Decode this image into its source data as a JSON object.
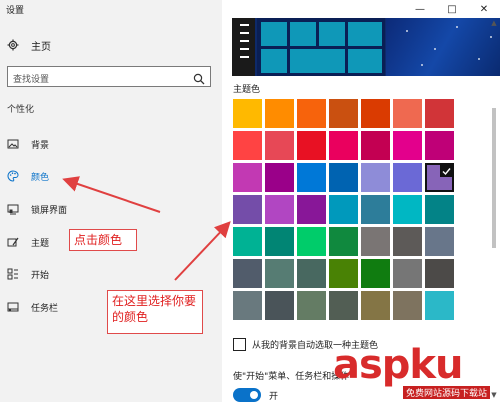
{
  "window": {
    "title": "设置"
  },
  "sidebar": {
    "home_label": "主页",
    "search_placeholder": "查找设置",
    "section_title": "个性化",
    "items": [
      {
        "label": "背景",
        "icon": "picture-icon"
      },
      {
        "label": "颜色",
        "icon": "palette-icon",
        "active": true
      },
      {
        "label": "锁屏界面",
        "icon": "lockscreen-icon"
      },
      {
        "label": "主题",
        "icon": "theme-icon"
      },
      {
        "label": "开始",
        "icon": "start-icon"
      },
      {
        "label": "任务栏",
        "icon": "taskbar-icon"
      }
    ]
  },
  "titlebar": {
    "minimize": "—",
    "maximize": "□",
    "close": "✕"
  },
  "main": {
    "theme_color_heading": "主题色",
    "selected_index": 20,
    "swatches": [
      "#FFB900",
      "#FF8C00",
      "#F7630C",
      "#CA5010",
      "#DA3B01",
      "#EF6950",
      "#D13438",
      "#FF4343",
      "#E74856",
      "#E81123",
      "#EA005E",
      "#C30052",
      "#E3008C",
      "#BF0077",
      "#C239B3",
      "#9A0089",
      "#0078D7",
      "#0063B1",
      "#8E8CD8",
      "#6B69D6",
      "#8764B8",
      "#744DA9",
      "#B146C2",
      "#881798",
      "#0099BC",
      "#2D7D9A",
      "#00B7C3",
      "#038387",
      "#00B294",
      "#018574",
      "#00CC6A",
      "#10893E",
      "#7A7574",
      "#5D5A58",
      "#68768A",
      "#515C6B",
      "#567C73",
      "#486860",
      "#498205",
      "#107C10",
      "#767676",
      "#4C4A48",
      "#69797E",
      "#4A5459",
      "#647C64",
      "#525E54",
      "#847545",
      "#7E735F",
      "#2BB8C8"
    ],
    "auto_pick_label": "从我的背景自动选取一种主题色",
    "start_taskbar_label": "使\"开始\"菜单、任务栏和操作",
    "toggle_label": "开"
  },
  "annotations": {
    "click_color": "点击颜色",
    "choose_color": "在这里选择你要的颜色"
  },
  "watermark": {
    "text": "aspku",
    "sub": "免费网站源码下载站"
  },
  "colors": {
    "accent": "#0A72C9",
    "annotation": "#E02020"
  }
}
